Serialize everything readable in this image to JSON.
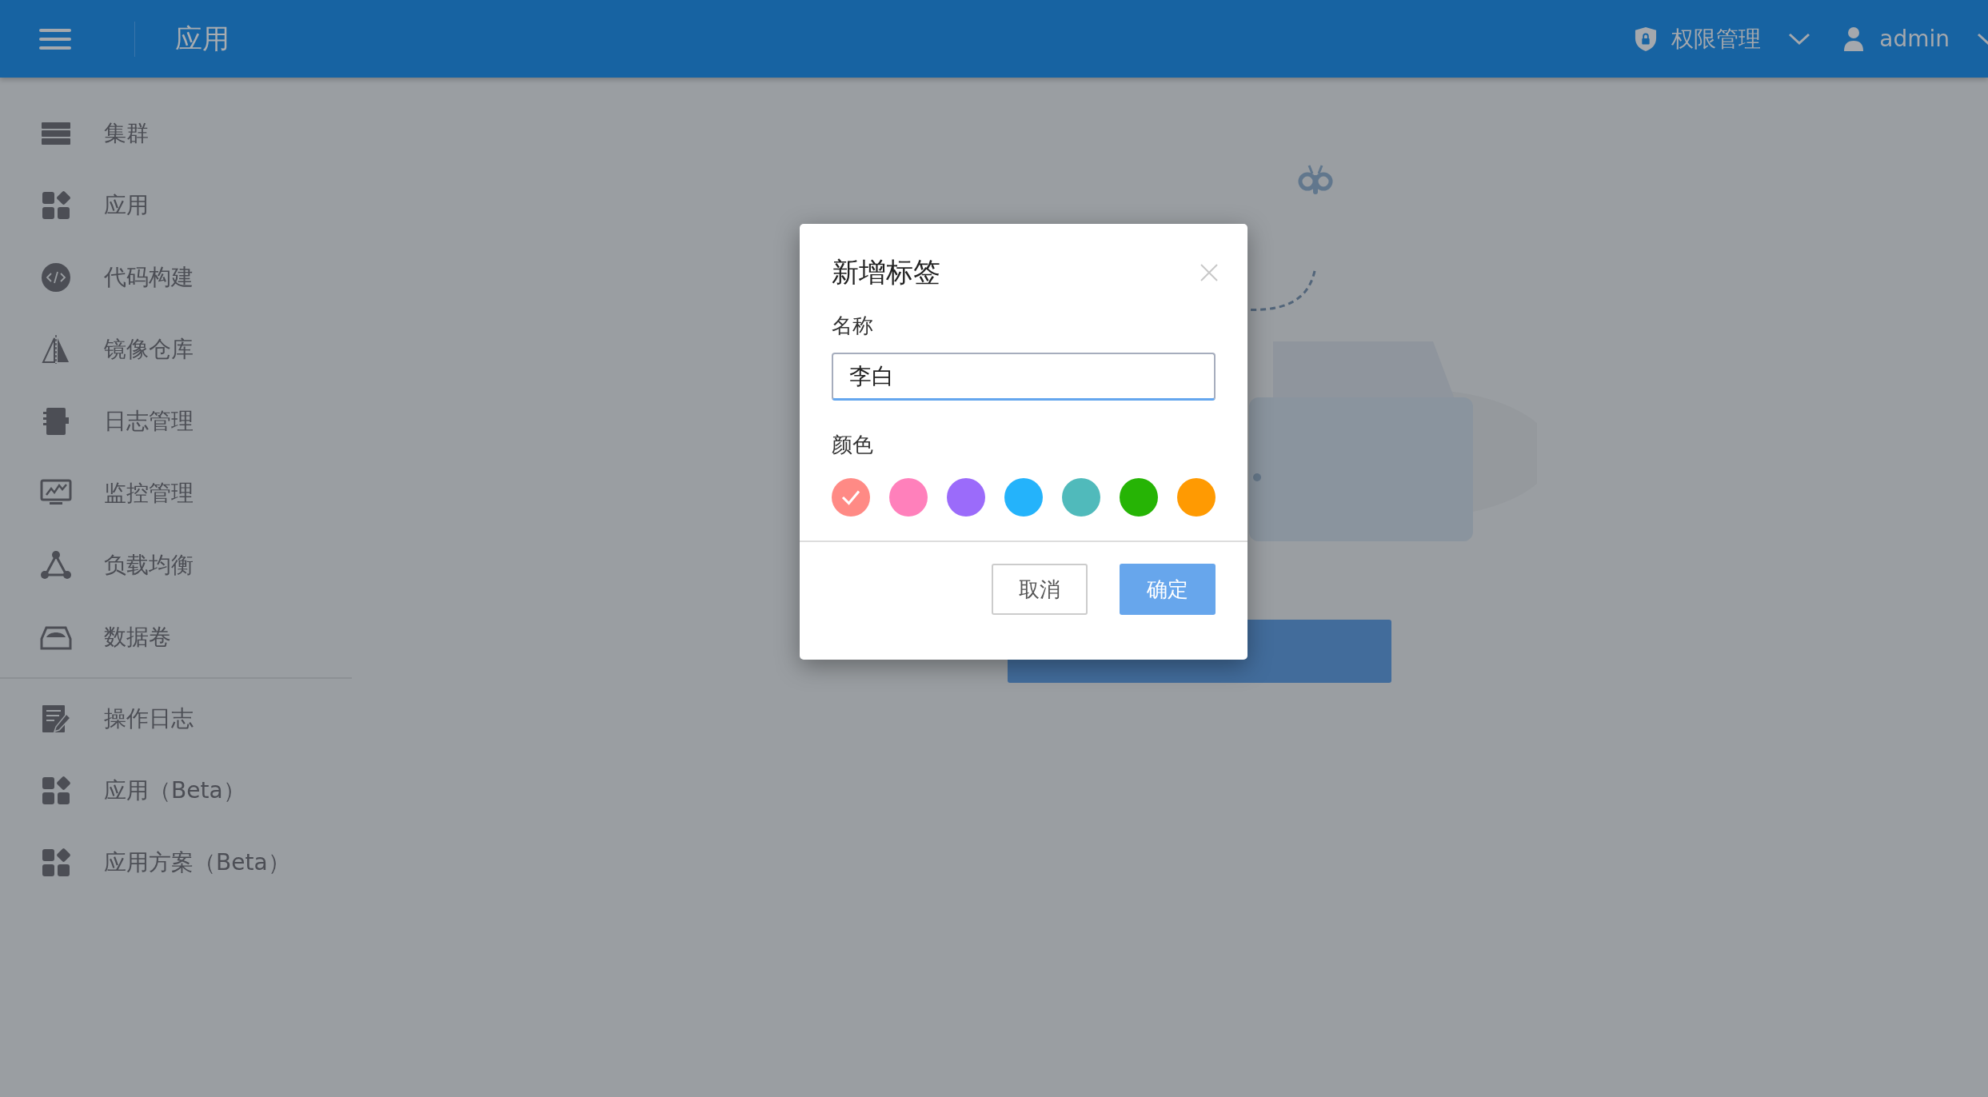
{
  "header": {
    "title": "应用",
    "menus": [
      {
        "label": "权限管理",
        "kind": "permissions"
      },
      {
        "label": "admin",
        "kind": "user"
      }
    ]
  },
  "sidebar": {
    "groups": [
      [
        {
          "label": "集群",
          "kind": "servers"
        },
        {
          "label": "应用",
          "kind": "apps"
        },
        {
          "label": "代码构建",
          "kind": "code"
        },
        {
          "label": "镜像仓库",
          "kind": "mirror"
        },
        {
          "label": "日志管理",
          "kind": "notebook"
        },
        {
          "label": "监控管理",
          "kind": "monitor"
        },
        {
          "label": "负载均衡",
          "kind": "network"
        },
        {
          "label": "数据卷",
          "kind": "drive"
        }
      ],
      [
        {
          "label": "操作日志",
          "kind": "log"
        },
        {
          "label": "应用（Beta）",
          "kind": "apps"
        },
        {
          "label": "应用方案（Beta）",
          "kind": "apps"
        }
      ]
    ]
  },
  "dialog": {
    "title": "新增标签",
    "name_label": "名称",
    "name_value": "李白",
    "color_label": "颜色",
    "colors": [
      {
        "color": "#ff8a85",
        "selected": true
      },
      {
        "color": "#ff80bb",
        "selected": false
      },
      {
        "color": "#9b6bfa",
        "selected": false
      },
      {
        "color": "#24b3fb",
        "selected": false
      },
      {
        "color": "#50babb",
        "selected": false
      },
      {
        "color": "#26b405",
        "selected": false
      },
      {
        "color": "#ff9a02",
        "selected": false
      }
    ],
    "buttons": [
      {
        "label": "取消",
        "kind": "secondary"
      },
      {
        "label": "确定",
        "kind": "primary"
      }
    ]
  }
}
